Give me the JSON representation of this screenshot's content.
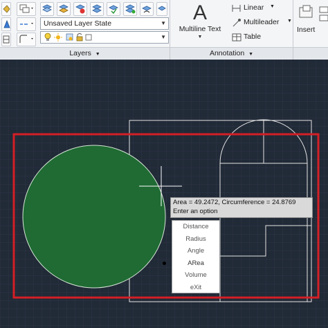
{
  "ribbon": {
    "layers": {
      "layer_state": "Unsaved Layer State",
      "panel_label": "Layers",
      "panel_arrow": "▼"
    },
    "annotation": {
      "multiline_text_glyph": "A",
      "multiline_text_label": "Multiline Text",
      "multiline_text_arrow": "▼",
      "linear_label": "Linear",
      "multileader_label": "Multileader",
      "table_label": "Table",
      "panel_label": "Annotation",
      "panel_arrow": "▼"
    },
    "insert_label": "Insert"
  },
  "canvas": {
    "tooltip": {
      "line1": "Area = 49.2472, Circumference = 24.8769",
      "line2": "Enter an option"
    },
    "option_menu": {
      "items": [
        {
          "label": "Distance"
        },
        {
          "label": "Radius"
        },
        {
          "label": "Angle"
        },
        {
          "label": "ARea",
          "current": true
        },
        {
          "label": "Volume"
        },
        {
          "label": "eXit"
        }
      ]
    }
  },
  "colors": {
    "canvas_bg": "#212a37",
    "grid": "#2e3747",
    "circle_fill": "#1f6b33",
    "highlight_frame": "#d41f26",
    "drawing_lines": "#e6e6e6"
  }
}
